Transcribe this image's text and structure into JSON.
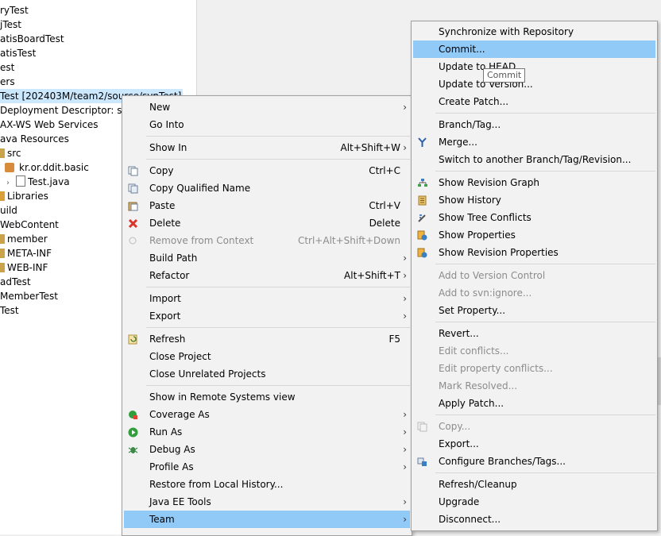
{
  "explorer": {
    "rows": [
      {
        "label": "ryTest"
      },
      {
        "label": "jTest"
      },
      {
        "label": "atisBoardTest"
      },
      {
        "label": "atisTest"
      },
      {
        "label": "est"
      },
      {
        "label": "ers"
      },
      {
        "label": "Test [202403M/team2/source/svnTest]"
      },
      {
        "label": "Deployment Descriptor: svnTe"
      },
      {
        "label": "AX-WS Web Services"
      },
      {
        "label": "ava Resources"
      },
      {
        "label": "src"
      },
      {
        "label": "kr.or.ddit.basic"
      },
      {
        "label": "Test.java"
      },
      {
        "label": "Libraries"
      },
      {
        "label": "uild"
      },
      {
        "label": "WebContent"
      },
      {
        "label": "member"
      },
      {
        "label": "META-INF"
      },
      {
        "label": "WEB-INF"
      },
      {
        "label": "adTest"
      },
      {
        "label": "MemberTest"
      },
      {
        "label": "Test"
      }
    ]
  },
  "context_menu": {
    "items": [
      {
        "label": "New",
        "arrow": "›"
      },
      {
        "label": "Go Into"
      },
      {
        "label": "Show In",
        "accel": "Alt+Shift+W",
        "arrow": "›"
      },
      {
        "label": "Copy",
        "accel": "Ctrl+C",
        "icon": "copy-icon"
      },
      {
        "label": "Copy Qualified Name",
        "icon": "copy-qualified-icon"
      },
      {
        "label": "Paste",
        "accel": "Ctrl+V",
        "icon": "paste-icon"
      },
      {
        "label": "Delete",
        "accel": "Delete",
        "icon": "delete-icon"
      },
      {
        "label": "Remove from Context",
        "accel": "Ctrl+Alt+Shift+Down",
        "icon": "remove-context-icon",
        "disabled": true
      },
      {
        "label": "Build Path",
        "arrow": "›"
      },
      {
        "label": "Refactor",
        "accel": "Alt+Shift+T",
        "arrow": "›"
      },
      {
        "label": "Import",
        "arrow": "›"
      },
      {
        "label": "Export",
        "arrow": "›"
      },
      {
        "label": "Refresh",
        "accel": "F5",
        "icon": "refresh-icon"
      },
      {
        "label": "Close Project"
      },
      {
        "label": "Close Unrelated Projects"
      },
      {
        "label": "Show in Remote Systems view"
      },
      {
        "label": "Coverage As",
        "icon": "coverage-icon",
        "arrow": "›"
      },
      {
        "label": "Run As",
        "icon": "run-icon",
        "arrow": "›"
      },
      {
        "label": "Debug As",
        "icon": "debug-icon",
        "arrow": "›"
      },
      {
        "label": "Profile As",
        "arrow": "›"
      },
      {
        "label": "Restore from Local History..."
      },
      {
        "label": "Java EE Tools",
        "arrow": "›"
      },
      {
        "label": "Team",
        "arrow": "›"
      }
    ]
  },
  "team_menu": {
    "items": [
      {
        "label": "Synchronize with Repository"
      },
      {
        "label": "Commit..."
      },
      {
        "label": "Update to HEAD"
      },
      {
        "label": "Update to Version..."
      },
      {
        "label": "Create Patch..."
      },
      {
        "label": "Branch/Tag..."
      },
      {
        "label": "Merge...",
        "icon": "merge-icon"
      },
      {
        "label": "Switch to another Branch/Tag/Revision..."
      },
      {
        "label": "Show Revision Graph",
        "icon": "revision-graph-icon"
      },
      {
        "label": "Show History",
        "icon": "history-icon"
      },
      {
        "label": "Show Tree Conflicts",
        "icon": "tree-conflicts-icon"
      },
      {
        "label": "Show Properties",
        "icon": "properties-icon"
      },
      {
        "label": "Show Revision Properties",
        "icon": "revision-properties-icon"
      },
      {
        "label": "Add to Version Control",
        "disabled": true
      },
      {
        "label": "Add to svn:ignore...",
        "disabled": true
      },
      {
        "label": "Set Property..."
      },
      {
        "label": "Revert..."
      },
      {
        "label": "Edit conflicts...",
        "disabled": true
      },
      {
        "label": "Edit property conflicts...",
        "disabled": true
      },
      {
        "label": "Mark Resolved...",
        "disabled": true
      },
      {
        "label": "Apply Patch..."
      },
      {
        "label": "Copy...",
        "icon": "copy-disabled-icon",
        "disabled": true
      },
      {
        "label": "Export..."
      },
      {
        "label": "Configure Branches/Tags...",
        "icon": "configure-icon"
      },
      {
        "label": "Refresh/Cleanup"
      },
      {
        "label": "Upgrade"
      },
      {
        "label": "Disconnect..."
      }
    ]
  },
  "tooltip": {
    "text": "Commit"
  },
  "colors": {
    "highlight": "#91c9f7",
    "selection": "#cce8ff",
    "menu_bg": "#f2f2f2"
  }
}
